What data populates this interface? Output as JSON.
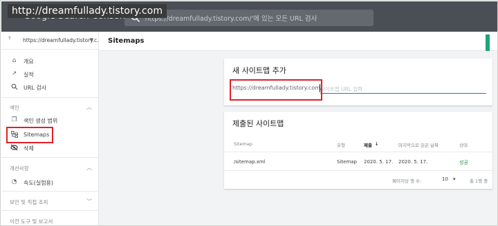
{
  "watermark": "http://dreamfullady.tistory.com",
  "header": {
    "brand": "Google Search Console",
    "search_placeholder": "'https://dreamfullady.tistory.com/'에 있는 모든 URL 검사"
  },
  "sidebar": {
    "property": "https://dreamfullady.tistory.c...",
    "items": [
      {
        "icon": "home-icon",
        "label": "개요"
      },
      {
        "icon": "trending-icon",
        "label": "실적"
      },
      {
        "icon": "search-icon",
        "label": "URL 검사"
      }
    ],
    "section_index": "색인",
    "index_items": [
      {
        "icon": "file-copy-icon",
        "label": "색인 생성 범위"
      },
      {
        "icon": "sitemap-icon",
        "label": "Sitemaps"
      },
      {
        "icon": "eye-off-icon",
        "label": "삭제"
      }
    ],
    "section_enhance": "개선사항",
    "enhance_items": [
      {
        "icon": "gauge-icon",
        "label": "속도(실험용)"
      }
    ],
    "section_security": "보안 및 직접 조치",
    "section_legacy": "이전 도구 및 보고서"
  },
  "main": {
    "title": "Sitemaps",
    "add": {
      "title": "새 사이트맵 추가",
      "prefix": "https://dreamfullady.tistory.com/",
      "placeholder": "사이트맵 URL 입력"
    },
    "submitted": {
      "title": "제출된 사이트맵",
      "columns": [
        "Sitemap",
        "유형",
        "제출",
        "마지막으로 읽은 날짜",
        "상태"
      ],
      "rows": [
        {
          "sitemap": "/sitemap.xml",
          "type": "Sitemap",
          "submitted": "2020. 5. 17.",
          "last_read": "2020. 5. 17.",
          "status": "성공"
        }
      ],
      "rows_per_page_label": "페이지당 행 수:",
      "rows_per_page": "10",
      "range": "총 1행 중"
    }
  },
  "colors": {
    "topbar": "#4a4f55",
    "highlight": "#e01f26",
    "accent": "#1fa37a",
    "success": "#1e8e3e",
    "link": "#1a73e8"
  }
}
